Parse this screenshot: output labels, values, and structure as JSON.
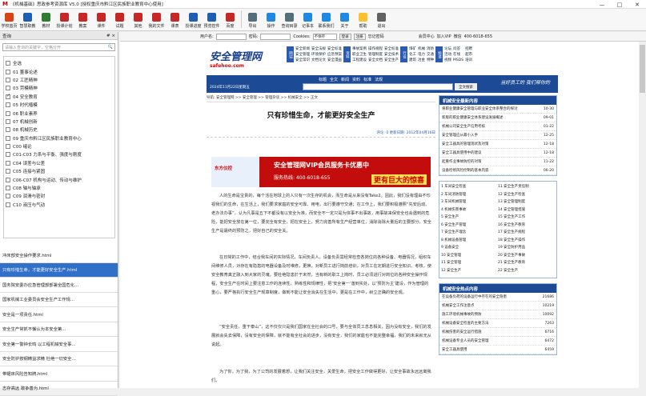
{
  "window": {
    "title": "《机械基础》思政参考资源库 V5.0 [授权重庆市黔江区民族职业教育中心使用]",
    "logo": "M",
    "controls": [
      "—",
      "□",
      "✕"
    ]
  },
  "toolbar": [
    {
      "label": "学校首页",
      "color": "#d84315"
    },
    {
      "label": "智慧职教",
      "color": "#1e5fb3"
    },
    {
      "label": "教材",
      "color": "#2e7d32"
    },
    {
      "label": "授课计划",
      "color": "#c62828"
    },
    {
      "label": "教案",
      "color": "#c62828"
    },
    {
      "label": "课件",
      "color": "#c62828"
    },
    {
      "label": "试题",
      "color": "#c62828"
    },
    {
      "label": "其他",
      "color": "#c62828"
    },
    {
      "label": "我的文件",
      "color": "#c62828"
    },
    {
      "label": "课表",
      "color": "#c62828"
    },
    {
      "label": "授课进度",
      "color": "#1e5fb3"
    },
    {
      "label": "预览控件",
      "color": "#1e5fb3"
    },
    {
      "label": "百度",
      "color": "#c62828"
    },
    {
      "label": "导出",
      "color": "#546e7a"
    },
    {
      "label": "操作",
      "color": "#1e88e5"
    },
    {
      "label": "查询目录",
      "color": "#546e7a"
    },
    {
      "label": "记事本",
      "color": "#1e88e5"
    },
    {
      "label": "联系我们",
      "color": "#1e88e5"
    },
    {
      "label": "关于",
      "color": "#1e88e5"
    },
    {
      "label": "帮助",
      "color": "#fbc02d"
    },
    {
      "label": "退出",
      "color": "#616161"
    }
  ],
  "left": {
    "header": "查询",
    "pin": "# ×",
    "search_placeholder": "请输入查询的关键字，空格分开",
    "tree": [
      {
        "label": "全选",
        "checked": false
      },
      {
        "label": "01 董事论述",
        "checked": false
      },
      {
        "label": "02 工匠精神",
        "checked": false
      },
      {
        "label": "03 劳模精神",
        "checked": false
      },
      {
        "label": "04 安全教育",
        "checked": true
      },
      {
        "label": "05 时代楷模",
        "checked": false
      },
      {
        "label": "06 职业素养",
        "checked": false
      },
      {
        "label": "07 机械创新",
        "checked": false
      },
      {
        "label": "08 机械历史",
        "checked": false
      },
      {
        "label": "09 重庆市黔江区民族职业教育中心",
        "checked": false
      },
      {
        "label": "C00 绪论",
        "checked": false
      },
      {
        "label": "C01-C03 力系与平衡、强度与刚度",
        "checked": false
      },
      {
        "label": "C04 误差与公差",
        "checked": false
      },
      {
        "label": "C05 连接与紧固",
        "checked": false
      },
      {
        "label": "C06-C07 机构与运动、传动与维护",
        "checked": false
      },
      {
        "label": "C08 轴与轴承",
        "checked": false
      },
      {
        "label": "C09 润滑与密封",
        "checked": false
      },
      {
        "label": "C10 液压与气动",
        "checked": false
      }
    ],
    "results": [
      "冲床部安全操作要求.html",
      "只有珍惜生命，才能更好安全生产.html",
      "国务院安委办应急管理部部署全国危化…",
      "国家机械工业委员会安全生产工作规…",
      "安全是一项责任.html",
      "安全生产常抓不懈认为本安全第…",
      "安全第一警钟长鸣 以工程机械安全事…",
      "安全防护按钢精益求精 杜绝一切安全…",
      "带锯床风险告知牌.html",
      "志存高远 敢争善为.html"
    ]
  },
  "nav": {
    "user_label": "用户名:",
    "pwd_label": "密码:",
    "cookies_label": "Cookies:",
    "cookies_value": "不保存",
    "login": "登录",
    "register": "注册",
    "forgot": "忘记密码",
    "vip": "会员中心",
    "vipjoin": "加入VIP",
    "wechat": "微信",
    "phone": "400-6018-655"
  },
  "site": {
    "logo": "安全管理网",
    "logo_sub": "safehoo.com",
    "nav_groups": [
      {
        "tag": "网站",
        "cols": [
          [
            "安全新闻",
            "安全管理",
            "安全常识"
          ],
          [
            "安全法规",
            "环境保护",
            "文档论文"
          ],
          [
            "安全标准",
            "应急预案",
            "安全漫画"
          ]
        ]
      },
      {
        "tag": "资料",
        "cols": [
          [
            "事故案例",
            "职业卫生",
            "工程建设"
          ],
          [
            "操作规程",
            "管理制度",
            "安全文档"
          ],
          [
            "安全标准",
            "安全技术",
            "安全生产"
          ]
        ]
      },
      {
        "tag": "行业",
        "cols": [
          [
            "煤矿",
            "化工",
            "建筑"
          ],
          [
            "机械",
            "电力",
            "冶金"
          ],
          [
            "消防",
            "交通",
            "特种"
          ]
        ]
      },
      {
        "tag": "频道",
        "cols": [
          [
            "论坛",
            "活动",
            "视频"
          ],
          [
            "问答",
            "在线",
            "MSDS"
          ],
          [
            "招聘",
            "超市",
            "培训"
          ]
        ]
      }
    ],
    "tabs": [
      "标题",
      "全文",
      "新闻",
      "资料",
      "标准",
      "法规"
    ],
    "search_btn": "全文搜索",
    "advanced": "高级搜索",
    "date": "2024年11月22日星期五",
    "slogan": "当好员工的 我们帮你的",
    "breadcrumb": "导航: 安全管理网 >> 安全管理 >> 管理杂谈 >> 机械安全 >> 正文",
    "article_title": "只有珍惜生命，才能更好安全生产",
    "meta": "评论: 0  更新日期: 2012年04月16日",
    "banner": {
      "brand": "东方仪控",
      "main": "安全管理网VIP会员服务卡优惠中",
      "phone": "服务热线: 400-6018-655",
      "promo": "更有巨大的惊喜"
    },
    "paragraphs": [
      "人的生命是宝贵的，每个活在地球上的人只有一次生存的机会，而生命是从来没有Take2。因此，我们没有理由不珍视我们的生命，在生活上，我们要求家庭的安全可靠、用电，出行要遵守交通；在工作上，我们要积极遵照“先安后动、老办法办事”，认为凡事是五下不都没有以安全为准，而安全不一定只是为体事不出事故，用事故来保安全也会遇到的危险，能把安全放在第一位，要完全有安全，把在安全上，努力完善所有生产经营单位，消除消除大量后的主要部分，安全生产是最终的预防之，把好自己的安全关。",
      "在日常的工作中，结合我车间的实际情况，车间负责人，设备负责需经常检查各岗位的各种设备、电器情况，组织车间维修人员，对存在有隐患的电器设备及时维修，更换，对新员工进行岗前培训，对员工在定期进行安全知识、考核，使安全教育真正融入到大家的灵魂，要杜绝隐患於于未然，当有新的职工上岗时，员工必须进行对岗位的各种安全操作规程，安全生产在时间上要注意工作的连续性、熟练性和规律性，把‘安全第一’落到实处，以‘预防为主’建设，作为管理的重心，要严格执行安全生产规章制度，做到不能让安全消失在生活中，更是在工作中，树立正确的安全观。",
      "“安全责任，重于泰山”，这不仅仅只是我们国家在全社会的口号，要与全体员工息息相关，因为没有安全，我们的发展就会失去保障，没有安全的保障，就不能有全社会的进步，没有安全，我们的家庭也不能完整幸福，我们的未来就无从说起。",
      "为了你，为了我，为了公司的发展着想，让我们关注安全，关爱生命，把安全工作做得更好，让安全事故永远远离我们。"
    ]
  },
  "right": {
    "box1_title": "机械安全最新内容",
    "box1_items": [
      {
        "t": "将职业健康安全管理与职业安全体系整合的探讨",
        "d": "10-30"
      },
      {
        "t": "新版的职业健康安全体系建设发展概述",
        "d": "09-01"
      },
      {
        "t": "机械公司安全生产信用考核",
        "d": "01-22"
      },
      {
        "t": "安全管理应从最小入手",
        "d": "12-25"
      },
      {
        "t": "安全工器具的管理现状及对策",
        "d": "12-18"
      },
      {
        "t": "安全工器具使用中的建议",
        "d": "12-18"
      },
      {
        "t": "起重作业事故防控的对策",
        "d": "11-22"
      },
      {
        "t": "设备检修风险控制的基本内容",
        "d": "06-20"
      }
    ],
    "grid": [
      [
        "1 车间安全检查",
        "11 安全生产责任制"
      ],
      [
        "2 车间消防管理",
        "12 安全生产检查"
      ],
      [
        "3 车间机械管理",
        "13 安全管理制度"
      ],
      [
        "4 机械伤害事故",
        "14 安全管理措施"
      ],
      [
        "5 安全生产",
        "15 安全生产工作"
      ],
      [
        "6 安全生产管理",
        "16 安全生产教育"
      ],
      [
        "7 安全生产理念",
        "17 安全生产规程"
      ],
      [
        "8 机械设备管理",
        "18 安全生产操作"
      ],
      [
        "9 设备安全",
        "19 安全防护用品"
      ],
      [
        "10 安全管理",
        "20 安全生产事故"
      ],
      [
        "11 安全管理",
        "21 安全生产教育"
      ],
      [
        "12 安全生产",
        "22 安全生产"
      ]
    ],
    "box2_title": "机械安全热点内容",
    "box2_items": [
      {
        "t": "在设备负荷的设备运行中存在的安全隐患",
        "d": "21686"
      },
      {
        "t": "机械安全工作注意点",
        "d": "10219"
      },
      {
        "t": "施工环境机械事故的预防",
        "d": "10092"
      },
      {
        "t": "机械设备安全检查的主要方法",
        "d": "7263"
      },
      {
        "t": "机械伤害的安全运行措施",
        "d": "6716"
      },
      {
        "t": "机械设备专业人员的安全管理",
        "d": "6472"
      },
      {
        "t": "安全工器具使用",
        "d": "6459"
      }
    ]
  }
}
